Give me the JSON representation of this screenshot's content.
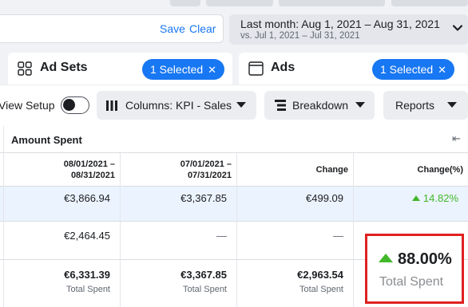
{
  "filters": {
    "save_label": "Save",
    "clear_label": "Clear"
  },
  "date_range": {
    "label": "Last month: Aug 1, 2021 – Aug 31, 2021",
    "compare": "vs. Jul 1, 2021 – Jul 31, 2021"
  },
  "tabs": {
    "ad_sets": {
      "label": "Ad Sets",
      "pill": "1 Selected",
      "icon": "grid-icon"
    },
    "ads": {
      "label": "Ads",
      "pill": "1 Selected",
      "icon": "ad-window-icon"
    }
  },
  "toolbar": {
    "view_setup": "View Setup",
    "columns": "Columns: KPI - Sales",
    "breakdown": "Breakdown",
    "reports": "Reports"
  },
  "table": {
    "group_title": "Amount Spent",
    "headers": {
      "period1_line1": "08/01/2021 –",
      "period1_line2": "08/31/2021",
      "period2_line1": "07/01/2021 –",
      "period2_line2": "07/31/2021",
      "change": "Change",
      "change_pct": "Change(%)"
    },
    "rows": [
      {
        "p1": "€3,866.94",
        "p2": "€3,367.85",
        "change": "€499.09",
        "pct": "14.82%"
      },
      {
        "p1": "€2,464.45",
        "p2": "—",
        "change": "—",
        "pct": ""
      }
    ],
    "totals": {
      "p1": "€6,331.39",
      "p2": "€3,367.85",
      "change": "€2,963.54",
      "pct": "88.00%",
      "sub": "Total Spent"
    }
  },
  "colors": {
    "accent": "#1877f2",
    "positive": "#42b72a",
    "highlight_border": "#e02020",
    "selected_row": "#ebf3ff"
  }
}
